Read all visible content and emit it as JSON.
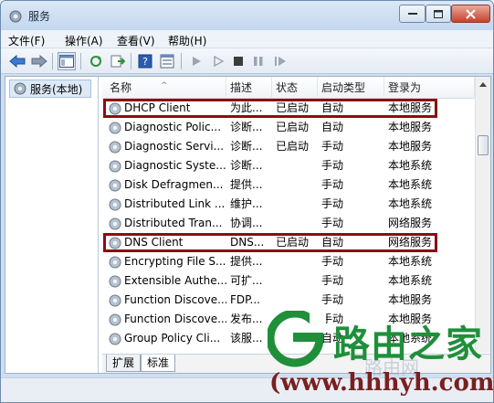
{
  "window": {
    "title": "服务"
  },
  "menu": [
    {
      "label": "文件(F)"
    },
    {
      "label": "操作(A)"
    },
    {
      "label": "查看(V)"
    },
    {
      "label": "帮助(H)"
    }
  ],
  "tree": {
    "root_label": "服务(本地)"
  },
  "columns": {
    "name": "名称",
    "desc": "描述",
    "status": "状态",
    "startup": "启动类型",
    "logon": "登录为"
  },
  "services": [
    {
      "name": "DHCP Client",
      "desc": "为此...",
      "status": "已启动",
      "startup": "自动",
      "logon": "本地服务",
      "highlighted": true
    },
    {
      "name": "Diagnostic Polic...",
      "desc": "诊断...",
      "status": "已启动",
      "startup": "自动",
      "logon": "本地服务",
      "highlighted": false
    },
    {
      "name": "Diagnostic Servi...",
      "desc": "诊断...",
      "status": "已启动",
      "startup": "手动",
      "logon": "本地服务",
      "highlighted": false
    },
    {
      "name": "Diagnostic Syste...",
      "desc": "诊断...",
      "status": "",
      "startup": "手动",
      "logon": "本地系统",
      "highlighted": false
    },
    {
      "name": "Disk Defragmen...",
      "desc": "提供...",
      "status": "",
      "startup": "手动",
      "logon": "本地系统",
      "highlighted": false
    },
    {
      "name": "Distributed Link ...",
      "desc": "维护...",
      "status": "",
      "startup": "手动",
      "logon": "本地系统",
      "highlighted": false
    },
    {
      "name": "Distributed Tran...",
      "desc": "协调...",
      "status": "",
      "startup": "手动",
      "logon": "网络服务",
      "highlighted": false
    },
    {
      "name": "DNS Client",
      "desc": "DNS...",
      "status": "已启动",
      "startup": "自动",
      "logon": "网络服务",
      "highlighted": true
    },
    {
      "name": "Encrypting File S...",
      "desc": "提供...",
      "status": "",
      "startup": "手动",
      "logon": "本地系统",
      "highlighted": false
    },
    {
      "name": "Extensible Authe...",
      "desc": "可扩...",
      "status": "",
      "startup": "手动",
      "logon": "本地系统",
      "highlighted": false
    },
    {
      "name": "Function Discove...",
      "desc": "FDP...",
      "status": "",
      "startup": "手动",
      "logon": "本地服务",
      "highlighted": false
    },
    {
      "name": "Function Discove...",
      "desc": "发布...",
      "status": "",
      "startup": "手动",
      "logon": "本地服务",
      "highlighted": false
    },
    {
      "name": "Group Policy Cli...",
      "desc": "该服...",
      "status": "",
      "startup": "自动",
      "logon": "本地系统",
      "highlighted": false
    }
  ],
  "tabs": [
    {
      "label": "扩展"
    },
    {
      "label": "标准"
    }
  ],
  "watermark": {
    "brand": "路由之家",
    "url": "(www.hhhyh.com)",
    "ghost": "路由网"
  },
  "colors": {
    "highlight_border": "#8b0d12",
    "watermark_green": "#1f8f3a",
    "watermark_url": "#7a1f1f"
  }
}
